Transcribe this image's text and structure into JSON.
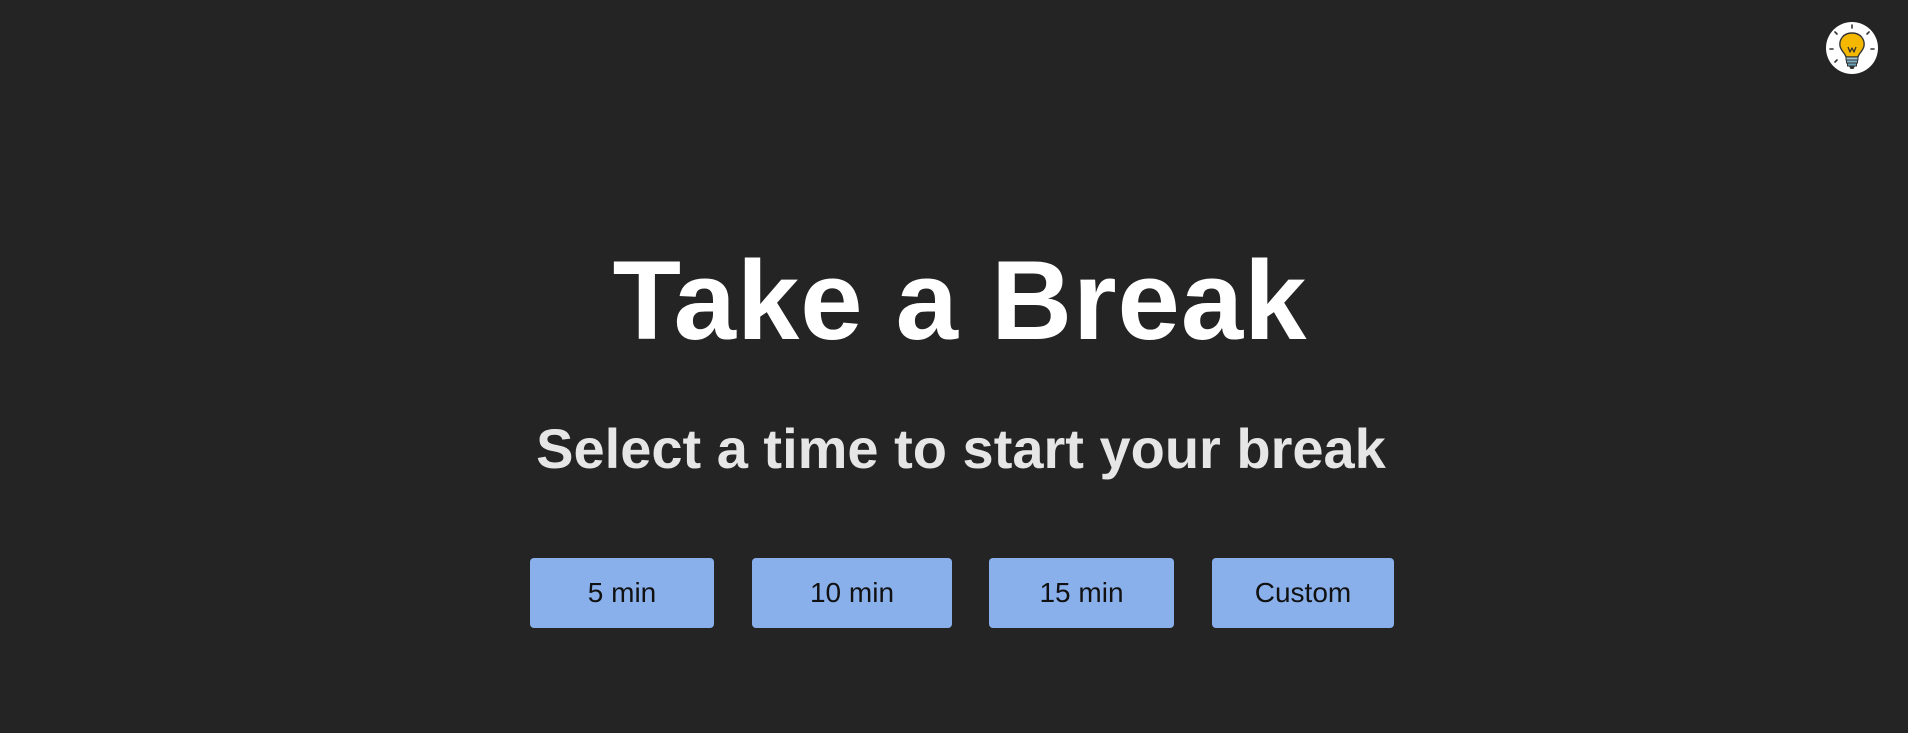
{
  "header": {
    "menu_icon": "lightbulb-icon"
  },
  "main": {
    "title": "Take a Break",
    "subtitle": "Select a time to start your break",
    "options": [
      {
        "label": "5 min"
      },
      {
        "label": "10 min"
      },
      {
        "label": "15 min"
      },
      {
        "label": "Custom"
      }
    ]
  },
  "colors": {
    "background": "#242424",
    "button": "#8ab0ec",
    "title_text": "#ffffff",
    "subtitle_text": "#e6e6e6",
    "bulb": "#f5b800"
  }
}
